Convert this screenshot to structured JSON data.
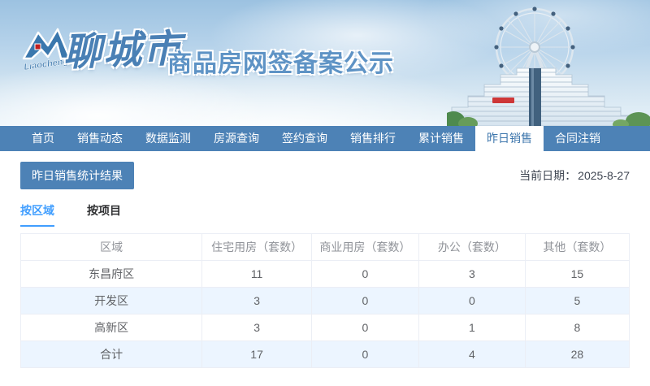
{
  "brand": {
    "logo_script": "Liaocheng",
    "city": "聊城市",
    "site_title": "商品房网签备案公示"
  },
  "nav": {
    "items": [
      {
        "label": "首页",
        "active": false
      },
      {
        "label": "销售动态",
        "active": false
      },
      {
        "label": "数据监测",
        "active": false
      },
      {
        "label": "房源查询",
        "active": false
      },
      {
        "label": "签约查询",
        "active": false
      },
      {
        "label": "销售排行",
        "active": false
      },
      {
        "label": "累计销售",
        "active": false
      },
      {
        "label": "昨日销售",
        "active": true
      },
      {
        "label": "合同注销",
        "active": false
      }
    ]
  },
  "toolbar": {
    "stats_button": "昨日销售统计结果",
    "date_label": "当前日期：",
    "date_value": "2025-8-27"
  },
  "view_tabs": {
    "items": [
      {
        "label": "按区域",
        "active": true
      },
      {
        "label": "按项目",
        "active": false
      }
    ]
  },
  "table": {
    "columns": [
      "区域",
      "住宅用房（套数）",
      "商业用房（套数）",
      "办公（套数）",
      "其他（套数）"
    ],
    "rows": [
      {
        "cells": [
          "东昌府区",
          "11",
          "0",
          "3",
          "15"
        ]
      },
      {
        "cells": [
          "开发区",
          "3",
          "0",
          "0",
          "5"
        ]
      },
      {
        "cells": [
          "高新区",
          "3",
          "0",
          "1",
          "8"
        ]
      },
      {
        "cells": [
          "合计",
          "17",
          "0",
          "4",
          "28"
        ]
      }
    ]
  },
  "colors": {
    "nav_blue": "#4d82b6",
    "accent_blue": "#409eff",
    "title_blue": "#5e93c5",
    "stripe_blue": "#ecf5ff",
    "border_gray": "#ebeef5",
    "logo_red": "#c01f1f"
  }
}
